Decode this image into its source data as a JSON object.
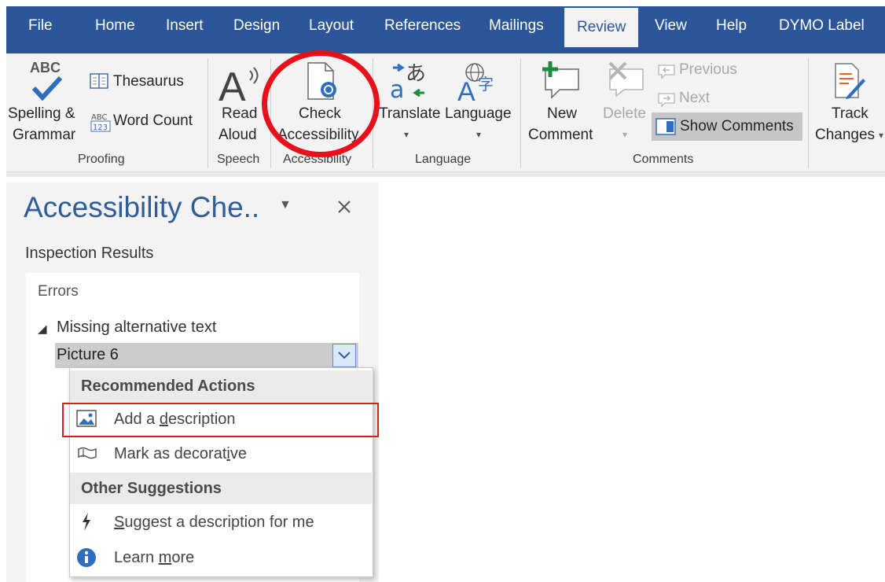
{
  "ribbon": {
    "tabs": [
      "File",
      "Home",
      "Insert",
      "Design",
      "Layout",
      "References",
      "Mailings",
      "Review",
      "View",
      "Help",
      "DYMO Label"
    ],
    "active_tab": "Review",
    "proofing": {
      "spelling_line1": "Spelling &",
      "spelling_line2": "Grammar",
      "thesaurus": "Thesaurus",
      "word_count": "Word Count",
      "abc_icon": "ABC",
      "group": "Proofing"
    },
    "speech": {
      "read_line1": "Read",
      "read_line2": "Aloud",
      "group": "Speech"
    },
    "accessibility": {
      "check_line1": "Check",
      "check_line2": "Accessibility",
      "group": "Accessibility"
    },
    "language": {
      "translate": "Translate",
      "language": "Language",
      "group": "Language"
    },
    "comments": {
      "new_line1": "New",
      "new_line2": "Comment",
      "delete": "Delete",
      "previous": "Previous",
      "next": "Next",
      "show_comments": "Show Comments",
      "group": "Comments"
    },
    "tracking": {
      "track_line1": "Track",
      "track_line2": "Changes"
    }
  },
  "pane": {
    "title": "Accessibility Che..",
    "inspection_results": "Inspection Results",
    "errors": "Errors",
    "issue": "Missing alternative text",
    "object": "Picture 6"
  },
  "menu": {
    "recommended_header": "Recommended Actions",
    "add_description": {
      "pre": "Add a ",
      "accel": "d",
      "post": "escription"
    },
    "mark_decorative": {
      "pre": "Mark as decorat",
      "accel": "i",
      "post": "ve"
    },
    "other_header": "Other Suggestions",
    "suggest": {
      "pre": "",
      "accel": "S",
      "post": "uggest a description for me"
    },
    "learn_more": {
      "pre": "Learn ",
      "accel": "m",
      "post": "ore"
    }
  },
  "colors": {
    "ribbon_blue": "#2b579a",
    "highlight_red": "#e8101a",
    "pane_title": "#2f5d9a"
  }
}
